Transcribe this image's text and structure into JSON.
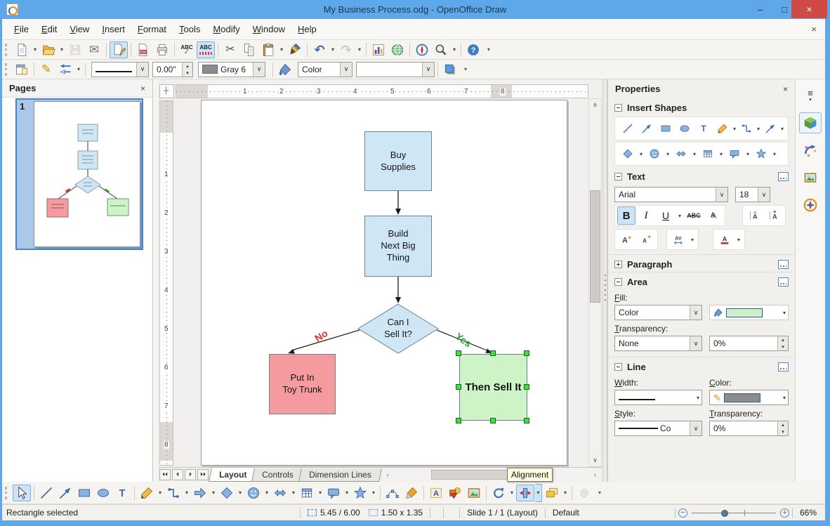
{
  "titlebar": {
    "title": "My Business Process.odg - OpenOffice Draw"
  },
  "menubar": {
    "items": [
      "File",
      "Edit",
      "View",
      "Insert",
      "Format",
      "Tools",
      "Modify",
      "Window",
      "Help"
    ]
  },
  "standard_toolbar": {
    "spellcheck_text": "ABC",
    "autospell_text": "ABC"
  },
  "line_fill_toolbar": {
    "width_value": "0.00\"",
    "line_color_name": "Gray 6",
    "fill_type": "Color",
    "line_color_hex": "#8c8c8c",
    "fill_color_hex": "#ffffff"
  },
  "pages_panel": {
    "title": "Pages",
    "page_number": "1"
  },
  "canvas": {
    "h_ruler": [
      "1",
      "2",
      "3",
      "4",
      "5",
      "6",
      "7",
      "8"
    ],
    "v_ruler": [
      "1",
      "2",
      "3",
      "4",
      "5",
      "6",
      "7",
      "8"
    ],
    "tabs": [
      {
        "label": "Layout"
      },
      {
        "label": "Controls"
      },
      {
        "label": "Dimension Lines"
      }
    ],
    "tooltip": "Alignment",
    "flowchart": {
      "node_buy": "Buy\nSupplies",
      "node_build": "Build\nNext Big\nThing",
      "node_decision": "Can I\nSell It?",
      "node_no": "Put In\nToy Trunk",
      "node_yes": "Then Sell It",
      "label_no": "No",
      "label_yes": "Yes",
      "colors": {
        "process_fill": "#cfe6f4",
        "no_fill": "#f59ba0",
        "yes_fill": "#cdf3c7",
        "border": "#6a7f8f",
        "selection_handle": "#3fdf3f",
        "label_no_color": "#d93030",
        "label_yes_color": "#2a9c2a"
      }
    }
  },
  "properties_panel": {
    "title": "Properties",
    "sections": {
      "insert_shapes": "Insert Shapes",
      "text": "Text",
      "paragraph": "Paragraph",
      "area": "Area",
      "line": "Line"
    },
    "text": {
      "font_name": "Arial",
      "font_size": "18",
      "bold": "B",
      "italic": "I",
      "underline": "U",
      "strikethrough": "ABC"
    },
    "area": {
      "fill_label": "Fill:",
      "fill_type": "Color",
      "transparency_label": "Transparency:",
      "transparency_type": "None",
      "transparency_value": "0%",
      "fill_color_hex": "#ccf0c8"
    },
    "line": {
      "width_label": "Width:",
      "color_label": "Color:",
      "style_label": "Style:",
      "transparency_label": "Transparency:",
      "style_value": "Co",
      "transparency_value": "0%",
      "line_color_hex": "#8c8c8c"
    }
  },
  "sidebar_tabs": {
    "items": [
      "properties",
      "gallery-effects",
      "images",
      "navigator"
    ]
  },
  "statusbar": {
    "selection": "Rectangle selected",
    "position": "5.45 / 6.00",
    "size": "1.50 x 1.35",
    "slide": "Slide 1 / 1 (Layout)",
    "style": "Default",
    "zoom": "66%"
  },
  "icons": {
    "dropdown": "▾",
    "close": "×",
    "minimize": "–",
    "maximize": "□",
    "cut": "✂",
    "mail": "✉",
    "pencil": "✎",
    "undo": "↶",
    "redo": "↷",
    "menu": "≡"
  }
}
